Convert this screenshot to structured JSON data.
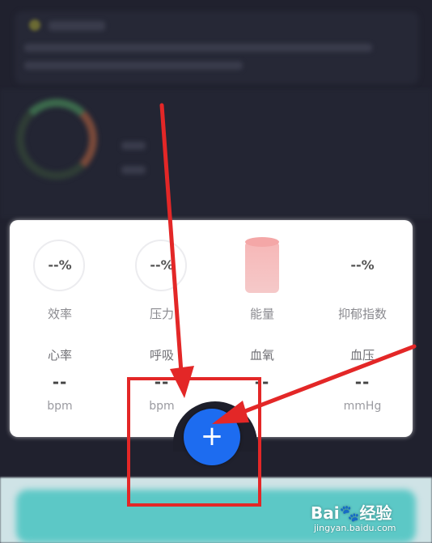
{
  "metrics_row1": [
    {
      "value": "--%",
      "label": "效率"
    },
    {
      "value": "--%",
      "label": "压力"
    },
    {
      "value": "",
      "label": "能量"
    },
    {
      "value": "--%",
      "label": "抑郁指数"
    }
  ],
  "metrics_row2": [
    {
      "label": "心率",
      "value": "--",
      "unit": "bpm"
    },
    {
      "label": "呼吸",
      "value": "--",
      "unit": "bpm"
    },
    {
      "label": "血氧",
      "value": "--",
      "unit": ""
    },
    {
      "label": "血压",
      "value": "--",
      "unit": "mmHg"
    }
  ],
  "fab": {
    "symbol": "+"
  },
  "watermark": {
    "brand": "Bai🐾经验",
    "url": "jingyan.baidu.com"
  },
  "colors": {
    "accent": "#1d6cf0",
    "annotation": "#e32727",
    "panel": "#ffffff",
    "background": "#1e1f2b"
  }
}
